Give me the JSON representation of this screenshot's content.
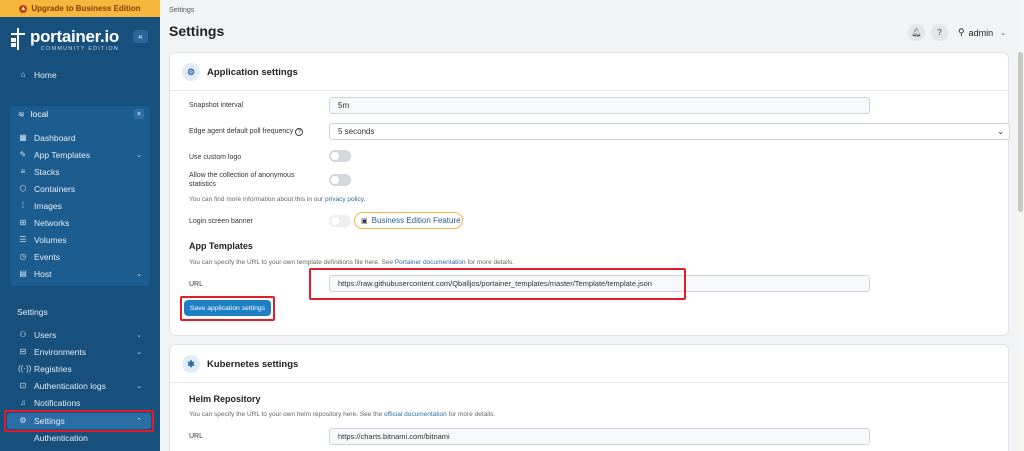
{
  "sidebar": {
    "upgrade_label": "Upgrade to Business Edition",
    "brand_name": "portainer.io",
    "brand_sub": "COMMUNITY EDITION",
    "collapse_label": "«",
    "home_label": "Home",
    "environment": {
      "name": "local",
      "close_label": "×"
    },
    "env_items": [
      {
        "label": "Dashboard",
        "icon": "dashboard-icon"
      },
      {
        "label": "App Templates",
        "icon": "edit-icon",
        "expandable": true
      },
      {
        "label": "Stacks",
        "icon": "stacks-icon"
      },
      {
        "label": "Containers",
        "icon": "container-icon"
      },
      {
        "label": "Images",
        "icon": "images-icon"
      },
      {
        "label": "Networks",
        "icon": "network-icon"
      },
      {
        "label": "Volumes",
        "icon": "database-icon"
      },
      {
        "label": "Events",
        "icon": "clock-icon"
      },
      {
        "label": "Host",
        "icon": "calendar-icon",
        "expandable": true
      }
    ],
    "settings_section_label": "Settings",
    "settings_items": [
      {
        "label": "Users",
        "icon": "users-icon",
        "expandable": true
      },
      {
        "label": "Environments",
        "icon": "environments-icon",
        "expandable": true
      },
      {
        "label": "Registries",
        "icon": "radio-icon"
      },
      {
        "label": "Authentication logs",
        "icon": "logs-icon",
        "expandable": true
      },
      {
        "label": "Notifications",
        "icon": "bell-icon"
      },
      {
        "label": "Settings",
        "icon": "gear-icon",
        "expandable": true,
        "active": true
      }
    ],
    "sub_item_label": "Authentication"
  },
  "header": {
    "breadcrumb": "Settings",
    "title": "Settings",
    "user_name": "admin"
  },
  "app_settings": {
    "title": "Application settings",
    "snapshot_interval": {
      "label": "Snapshot interval",
      "value": "5m"
    },
    "edge_poll": {
      "label": "Edge agent default poll frequency",
      "value": "5 seconds"
    },
    "custom_logo": {
      "label": "Use custom logo",
      "enabled": false
    },
    "anonymous_stats": {
      "label_line1": "Allow the collection of anonymous",
      "label_line2": "statistics",
      "enabled": false
    },
    "privacy_text_prefix": "You can find more information about this in our ",
    "privacy_link": "privacy policy",
    "privacy_text_suffix": ".",
    "login_banner": {
      "label": "Login screen banner",
      "badge": "Business Edition Feature"
    },
    "templates_heading": "App Templates",
    "templates_help_prefix": "You can specify the URL to your own template definitions file here. See ",
    "templates_help_link": "Portainer documentation",
    "templates_help_suffix": " for more details.",
    "url_label": "URL",
    "url_value": "https://raw.githubusercontent.com/Qballjos/portainer_templates/master/Template/template.json",
    "save_label": "Save application settings"
  },
  "kube_settings": {
    "title": "Kubernetes settings",
    "helm_heading": "Helm Repository",
    "helm_help_prefix": "You can specify the URL to your own helm repository here. See the ",
    "helm_help_link": "official documentation",
    "helm_help_suffix": " for more details.",
    "url_label": "URL",
    "url_value": "https://charts.bitnami.com/bitnami"
  },
  "colors": {
    "sidebar": "#17507d",
    "accent": "#1f7fc4",
    "highlight": "#e11d2a",
    "upgrade": "#f6b73c"
  }
}
